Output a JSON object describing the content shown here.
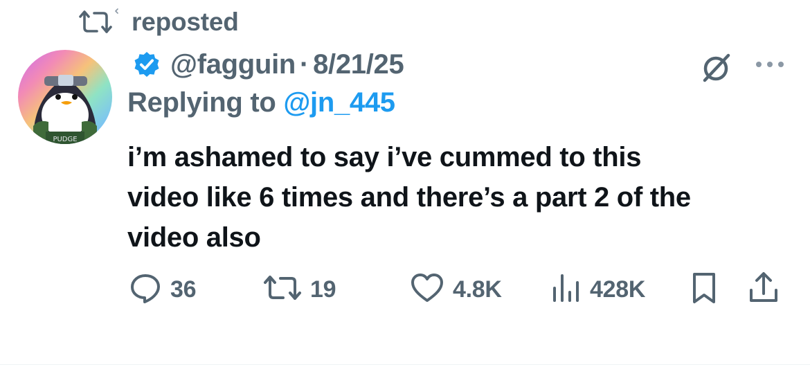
{
  "repost": {
    "label": "reposted",
    "icon": "repost-icon"
  },
  "author": {
    "avatar_badge_text": "PUDGE",
    "verified_icon": "verified-badge-icon",
    "handle": "@fagguin",
    "separator": "·",
    "date": "8/21/25"
  },
  "actions_top": {
    "grok_icon": "grok-icon",
    "more_icon": "more-icon"
  },
  "reply": {
    "prefix": "Replying to",
    "mention": "@jn_445"
  },
  "tweet": {
    "lines": [
      "i’m ashamed to say i’ve cummed to this",
      "video like 6 times and there’s a part 2 of the",
      "video also"
    ]
  },
  "stats": {
    "replies": "36",
    "reposts": "19",
    "likes": "4.8K",
    "views": "428K"
  },
  "colors": {
    "text": "#0f1419",
    "secondary": "#536471",
    "accent": "#1d9bf0"
  }
}
